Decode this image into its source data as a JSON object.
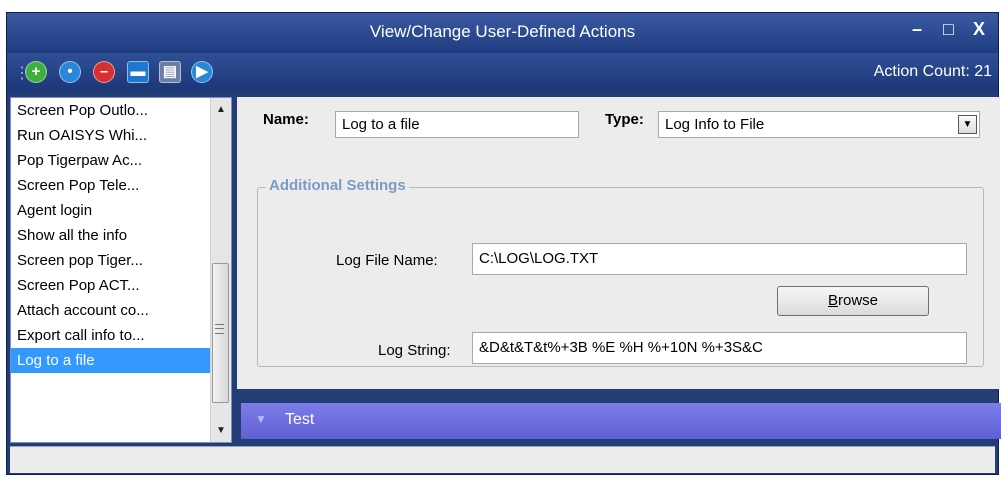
{
  "window": {
    "title": "View/Change User-Defined Actions",
    "minimize": "–",
    "maximize": "□",
    "close": "X"
  },
  "toolbar": {
    "grip": "⋮",
    "buttons": [
      {
        "icon": "add-icon",
        "glyph": "+",
        "color": "#3fae3f"
      },
      {
        "icon": "copy-icon",
        "glyph": "•",
        "color": "#2a86d8"
      },
      {
        "icon": "delete-icon",
        "glyph": "–",
        "color": "#d83030"
      },
      {
        "icon": "save-icon",
        "glyph": "▬",
        "color": "#1e78d0"
      },
      {
        "icon": "import-icon",
        "glyph": "▤",
        "color": "#6b7fa6"
      },
      {
        "icon": "run-icon",
        "glyph": "▶",
        "color": "#2a86d8"
      }
    ],
    "action_count": "Action Count: 21"
  },
  "actions_list": {
    "items": [
      "Screen Pop Outlo...",
      "Run OAISYS Whi...",
      "Pop Tigerpaw Ac...",
      "Screen Pop Tele...",
      "Agent login",
      "Show all the info",
      "Screen pop Tiger...",
      "Screen Pop ACT...",
      "Attach account co...",
      "Export call info to...",
      "Log to a file"
    ],
    "selected_index": 10
  },
  "form": {
    "name_label": "Name:",
    "name_value": "Log to a file",
    "type_label": "Type:",
    "type_value": "Log Info to File",
    "group_title": "Additional Settings",
    "log_file_label": "Log File Name:",
    "log_file_value": "C:\\LOG\\LOG.TXT",
    "browse_label": "Browse",
    "log_string_label": "Log String:",
    "log_string_value": "&D&t&T&t%+3B %E %H %+10N %+3S&C"
  },
  "test_tab": {
    "label": "Test"
  }
}
